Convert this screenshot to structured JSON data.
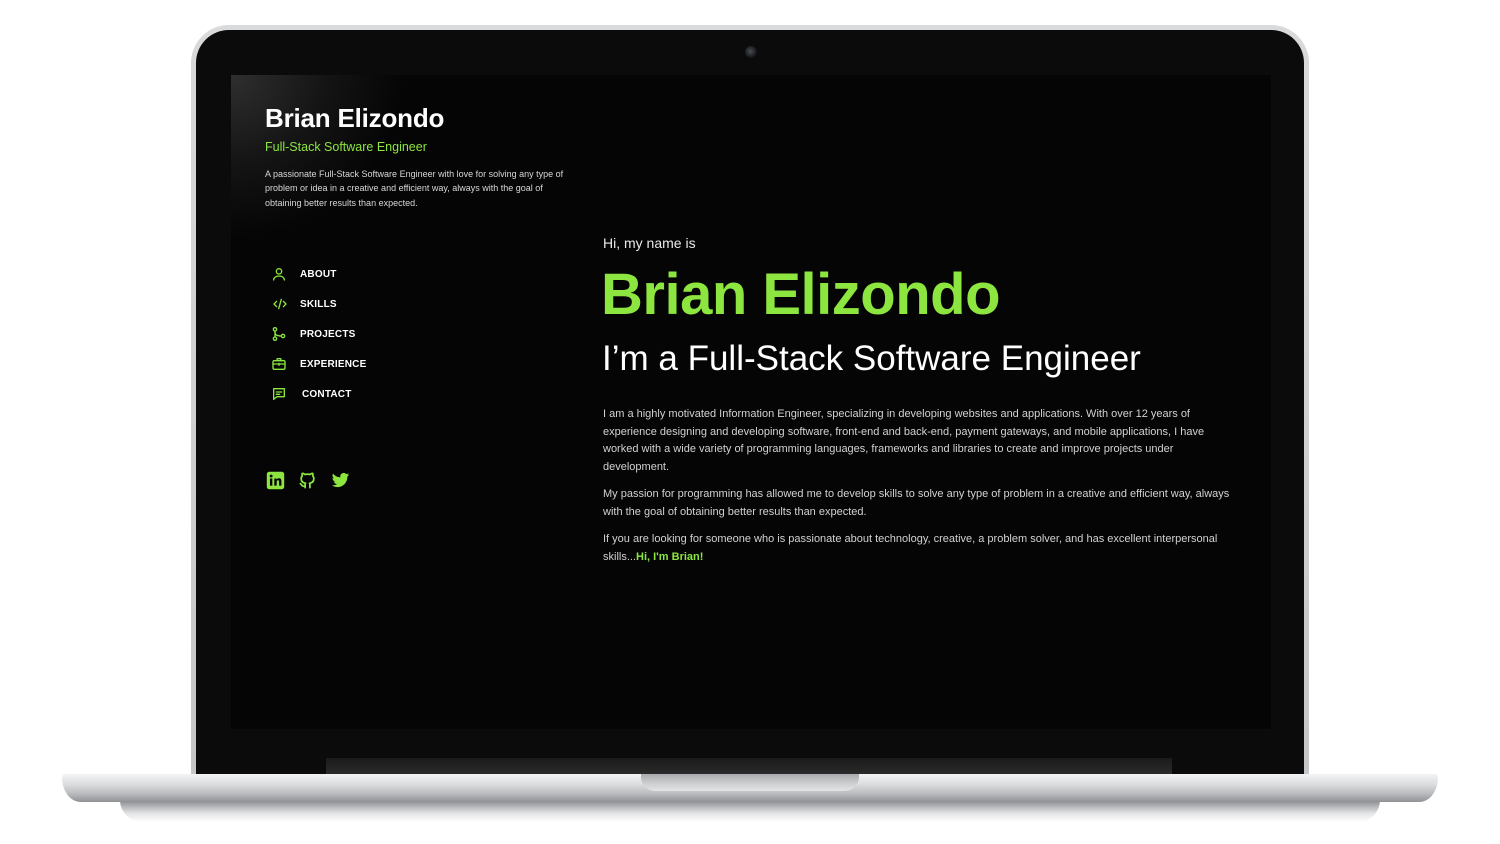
{
  "sidebar": {
    "name": "Brian Elizondo",
    "title": "Full-Stack Software Engineer",
    "description": "A passionate Full-Stack Software Engineer with love for solving any type of problem or idea in a creative and efficient way, always with the goal of obtaining better results than expected.",
    "nav": [
      {
        "label": "ABOUT",
        "icon": "user-icon"
      },
      {
        "label": "SKILLS",
        "icon": "code-icon"
      },
      {
        "label": "PROJECTS",
        "icon": "git-branch-icon"
      },
      {
        "label": "EXPERIENCE",
        "icon": "briefcase-icon"
      },
      {
        "label": "CONTACT",
        "icon": "message-icon"
      }
    ],
    "social": [
      "linkedin-icon",
      "github-icon",
      "twitter-icon"
    ]
  },
  "main": {
    "greeting": "Hi, my name is",
    "name": "Brian Elizondo",
    "role": "I’m a Full-Stack Software Engineer",
    "paragraphs": [
      "I am a highly motivated Information Engineer, specializing in developing websites and applications. With over 12 years of experience designing and developing software, front-end and back-end, payment gateways, and mobile applications, I have worked with a wide variety of programming languages, frameworks and libraries to create and improve projects under development.",
      "My passion for programming has allowed me to develop skills to solve any type of problem in a creative and efficient way, always with the goal of obtaining better results than expected.",
      "If you are looking for someone who is passionate about technology, creative, a problem solver, and has excellent interpersonal skills..."
    ],
    "highlight": "Hi, I'm Brian!"
  },
  "colors": {
    "accent": "#8ce63f",
    "background": "#050505",
    "text": "#ffffff"
  }
}
